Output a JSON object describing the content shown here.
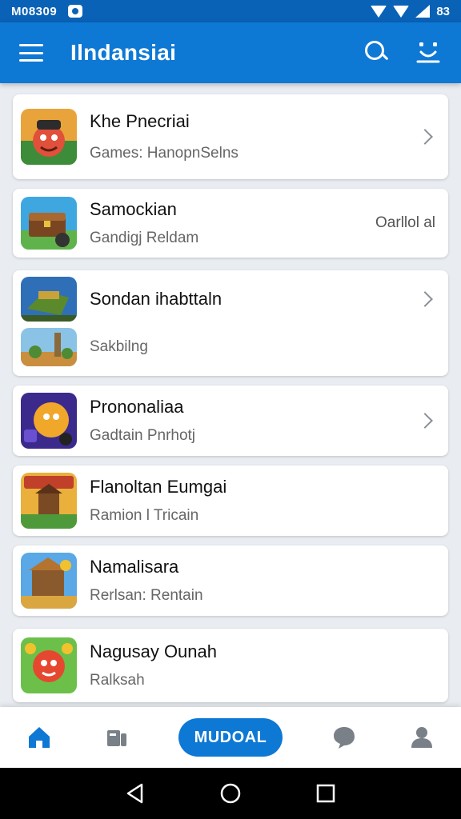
{
  "status_bar": {
    "time": "M08309",
    "battery": "83"
  },
  "app_bar": {
    "title": "Ilndansiai"
  },
  "items": [
    {
      "title": "Khe Pnecriai",
      "subtitle": "Games: HanopnSelns",
      "right": "",
      "chevron": true
    },
    {
      "title": "Samockian",
      "subtitle": "Gandigj Reldam",
      "right": "Oarllol al",
      "chevron": false
    },
    {
      "title": "Sondan ihabttaln",
      "subtitle": "Sakbilng",
      "right": "",
      "chevron": true
    },
    {
      "title": "Prononaliaa",
      "subtitle": "Gadtain Pnrhotj",
      "right": "",
      "chevron": true
    },
    {
      "title": "Flanoltan Eumgai",
      "subtitle": "Ramion l Tricain",
      "right": "",
      "chevron": false
    },
    {
      "title": "Namalisara",
      "subtitle": "Rerlsan: Rentain",
      "right": "",
      "chevron": false
    },
    {
      "title": "Nagusay Ounah",
      "subtitle": "Ralksah",
      "right": "",
      "chevron": false
    }
  ],
  "bottom_nav": {
    "center_label": "MUDOAL"
  },
  "colors": {
    "primary": "#0e78d5",
    "status": "#0a62b7",
    "background": "#e9edf2"
  }
}
